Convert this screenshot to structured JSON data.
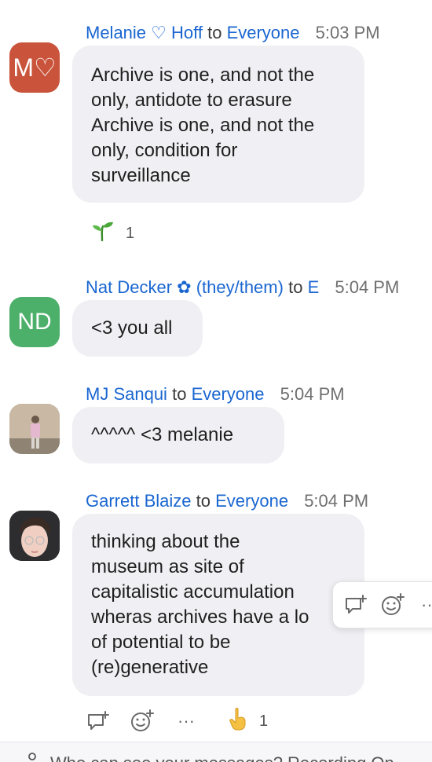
{
  "messages": [
    {
      "avatar_text": "M♡",
      "avatar_color": "#c9543b",
      "sender": "Melanie ♡ Hoff",
      "to_word": "to",
      "recipient": "Everyone",
      "time": "5:03 PM",
      "lines": [
        "Archive is one, and not the",
        "only, antidote to erasure",
        "Archive is one, and not the",
        "only, condition for",
        "surveillance"
      ],
      "reaction": {
        "emoji": "seedling",
        "count": "1"
      }
    },
    {
      "avatar_text": "ND",
      "avatar_color": "#4caf6a",
      "sender": "Nat Decker ✿ (they/them)",
      "to_word": "to",
      "recipient": "E",
      "time": "5:04 PM",
      "lines": [
        "<3 you all"
      ]
    },
    {
      "avatar_text": "",
      "sender": "MJ Sanqui",
      "to_word": "to",
      "recipient": "Everyone",
      "time": "5:04 PM",
      "lines": [
        "^^^^^ <3 melanie"
      ]
    },
    {
      "avatar_text": "",
      "sender": "Garrett Blaize",
      "to_word": "to",
      "recipient": "Everyone",
      "time": "5:04 PM",
      "lines": [
        "thinking about the",
        "museum as site of",
        "capitalistic accumulation",
        "wheras archives have a lo",
        "of potential to be",
        "(re)generative"
      ],
      "reaction": {
        "emoji": "pointing-up-hand",
        "count": "1"
      }
    }
  ],
  "toolbar": {
    "reply_icon": "reply-thread-icon",
    "emoji_icon": "add-emoji-icon",
    "more_icon": "more-icon",
    "more_glyph": "···"
  },
  "footer": {
    "hint": "Who can see your messages? Recording On"
  },
  "colors": {
    "link": "#1a66d1",
    "bubble": "#f0f0f4"
  }
}
